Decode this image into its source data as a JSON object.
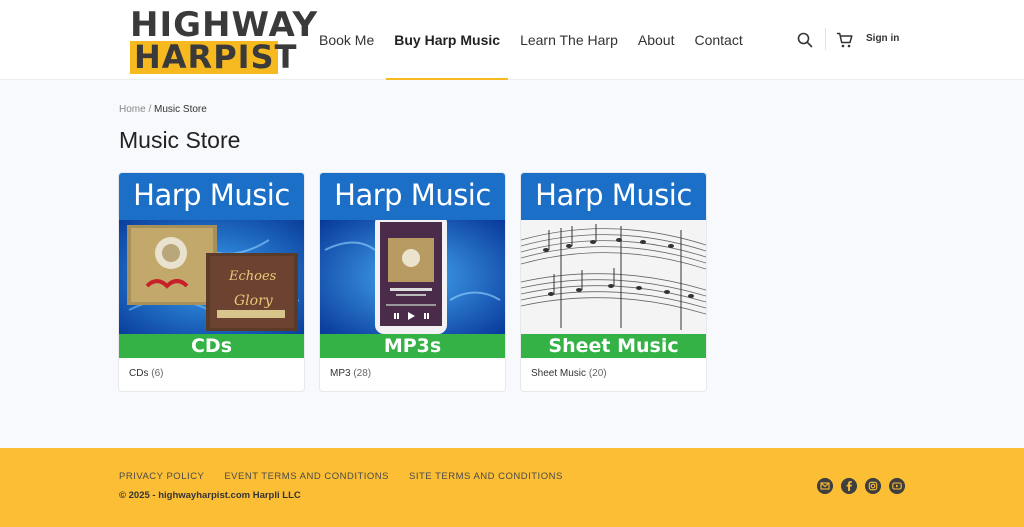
{
  "logo": {
    "line1": "HIGHWAY",
    "line2": "HARPIST"
  },
  "nav": [
    {
      "label": "Book Me",
      "active": false
    },
    {
      "label": "Buy Harp Music",
      "active": true
    },
    {
      "label": "Learn The Harp",
      "active": false
    },
    {
      "label": "About",
      "active": false
    },
    {
      "label": "Contact",
      "active": false
    }
  ],
  "header": {
    "signin": "Sign in",
    "icons": [
      "search-icon",
      "cart-icon"
    ]
  },
  "breadcrumb": {
    "home": "Home",
    "sep": " / ",
    "current": "Music Store"
  },
  "page_title": "Music Store",
  "cards": [
    {
      "top": "Harp Music",
      "bottom": "CDs",
      "label": "CDs",
      "count": "(6)"
    },
    {
      "top": "Harp Music",
      "bottom": "MP3s",
      "label": "MP3",
      "count": "(28)"
    },
    {
      "top": "Harp Music",
      "bottom": "Sheet Music",
      "label": "Sheet Music",
      "count": "(20)"
    }
  ],
  "footer": {
    "links": [
      "PRIVACY POLICY",
      "EVENT TERMS AND CONDITIONS",
      "SITE TERMS AND CONDITIONS"
    ],
    "copyright": "© 2025 - highwayharpist.com Harpli LLC",
    "socials": [
      "email-icon",
      "facebook-icon",
      "instagram-icon",
      "youtube-icon"
    ]
  },
  "colors": {
    "accent": "#f6b91f",
    "footer_bg": "#fbbe35",
    "card_blue": "#1c6fc6",
    "card_green": "#34b246"
  }
}
